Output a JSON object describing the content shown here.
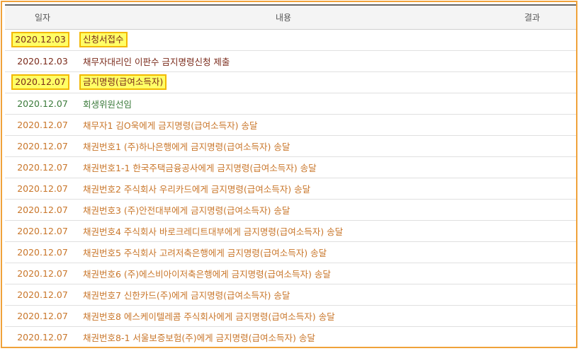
{
  "table": {
    "headers": {
      "date": "일자",
      "content": "내용",
      "result": "결과"
    },
    "colors": {
      "dark": "#7a2a1a",
      "green": "#3a7a3a",
      "orange": "#c9762a",
      "highlight_fill": "#ffff66",
      "highlight_border": "#f2b800"
    },
    "rows": [
      {
        "date": "2020.12.03",
        "content": "신청서접수",
        "result": "",
        "color": "dark",
        "highlighted": true
      },
      {
        "date": "2020.12.03",
        "content": "채무자대리인 이판수 금지명령신청 제출",
        "result": "",
        "color": "dark",
        "highlighted": false
      },
      {
        "date": "2020.12.07",
        "content": "금지명령(급여소득자)",
        "result": "",
        "color": "dark",
        "highlighted": true
      },
      {
        "date": "2020.12.07",
        "content": "회생위원선임",
        "result": "",
        "color": "green",
        "highlighted": false
      },
      {
        "date": "2020.12.07",
        "content": "채무자1 김O욱에게 금지명령(급여소득자) 송달",
        "result": "",
        "color": "orange",
        "highlighted": false
      },
      {
        "date": "2020.12.07",
        "content": "채권번호1 (주)하나은행에게 금지명령(급여소득자) 송달",
        "result": "",
        "color": "orange",
        "highlighted": false
      },
      {
        "date": "2020.12.07",
        "content": "채권번호1-1 한국주택금융공사에게 금지명령(급여소득자) 송달",
        "result": "",
        "color": "orange",
        "highlighted": false
      },
      {
        "date": "2020.12.07",
        "content": "채권번호2 주식회사 우리카드에게 금지명령(급여소득자) 송달",
        "result": "",
        "color": "orange",
        "highlighted": false
      },
      {
        "date": "2020.12.07",
        "content": "채권번호3 (주)안전대부에게 금지명령(급여소득자) 송달",
        "result": "",
        "color": "orange",
        "highlighted": false
      },
      {
        "date": "2020.12.07",
        "content": "채권번호4 주식회사 바로크레디트대부에게 금지명령(급여소득자) 송달",
        "result": "",
        "color": "orange",
        "highlighted": false
      },
      {
        "date": "2020.12.07",
        "content": "채권번호5 주식회사 고려저축은행에게 금지명령(급여소득자) 송달",
        "result": "",
        "color": "orange",
        "highlighted": false
      },
      {
        "date": "2020.12.07",
        "content": "채권번호6 (주)에스비아이저축은행에게 금지명령(급여소득자) 송달",
        "result": "",
        "color": "orange",
        "highlighted": false
      },
      {
        "date": "2020.12.07",
        "content": "채권번호7 신한카드(주)에게 금지명령(급여소득자) 송달",
        "result": "",
        "color": "orange",
        "highlighted": false
      },
      {
        "date": "2020.12.07",
        "content": "채권번호8 에스케이텔레콤 주식회사에게 금지명령(급여소득자) 송달",
        "result": "",
        "color": "orange",
        "highlighted": false
      },
      {
        "date": "2020.12.07",
        "content": "채권번호8-1 서울보증보험(주)에게 금지명령(급여소득자) 송달",
        "result": "",
        "color": "orange",
        "highlighted": false
      }
    ]
  }
}
